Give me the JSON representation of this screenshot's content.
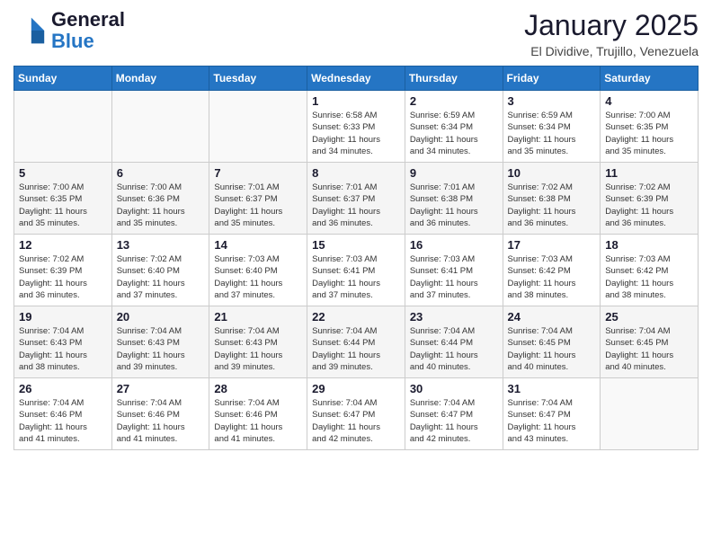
{
  "header": {
    "logo_general": "General",
    "logo_blue": "Blue",
    "month": "January 2025",
    "location": "El Dividive, Trujillo, Venezuela"
  },
  "days_of_week": [
    "Sunday",
    "Monday",
    "Tuesday",
    "Wednesday",
    "Thursday",
    "Friday",
    "Saturday"
  ],
  "weeks": [
    [
      {
        "day": "",
        "info": ""
      },
      {
        "day": "",
        "info": ""
      },
      {
        "day": "",
        "info": ""
      },
      {
        "day": "1",
        "info": "Sunrise: 6:58 AM\nSunset: 6:33 PM\nDaylight: 11 hours\nand 34 minutes."
      },
      {
        "day": "2",
        "info": "Sunrise: 6:59 AM\nSunset: 6:34 PM\nDaylight: 11 hours\nand 34 minutes."
      },
      {
        "day": "3",
        "info": "Sunrise: 6:59 AM\nSunset: 6:34 PM\nDaylight: 11 hours\nand 35 minutes."
      },
      {
        "day": "4",
        "info": "Sunrise: 7:00 AM\nSunset: 6:35 PM\nDaylight: 11 hours\nand 35 minutes."
      }
    ],
    [
      {
        "day": "5",
        "info": "Sunrise: 7:00 AM\nSunset: 6:35 PM\nDaylight: 11 hours\nand 35 minutes."
      },
      {
        "day": "6",
        "info": "Sunrise: 7:00 AM\nSunset: 6:36 PM\nDaylight: 11 hours\nand 35 minutes."
      },
      {
        "day": "7",
        "info": "Sunrise: 7:01 AM\nSunset: 6:37 PM\nDaylight: 11 hours\nand 35 minutes."
      },
      {
        "day": "8",
        "info": "Sunrise: 7:01 AM\nSunset: 6:37 PM\nDaylight: 11 hours\nand 36 minutes."
      },
      {
        "day": "9",
        "info": "Sunrise: 7:01 AM\nSunset: 6:38 PM\nDaylight: 11 hours\nand 36 minutes."
      },
      {
        "day": "10",
        "info": "Sunrise: 7:02 AM\nSunset: 6:38 PM\nDaylight: 11 hours\nand 36 minutes."
      },
      {
        "day": "11",
        "info": "Sunrise: 7:02 AM\nSunset: 6:39 PM\nDaylight: 11 hours\nand 36 minutes."
      }
    ],
    [
      {
        "day": "12",
        "info": "Sunrise: 7:02 AM\nSunset: 6:39 PM\nDaylight: 11 hours\nand 36 minutes."
      },
      {
        "day": "13",
        "info": "Sunrise: 7:02 AM\nSunset: 6:40 PM\nDaylight: 11 hours\nand 37 minutes."
      },
      {
        "day": "14",
        "info": "Sunrise: 7:03 AM\nSunset: 6:40 PM\nDaylight: 11 hours\nand 37 minutes."
      },
      {
        "day": "15",
        "info": "Sunrise: 7:03 AM\nSunset: 6:41 PM\nDaylight: 11 hours\nand 37 minutes."
      },
      {
        "day": "16",
        "info": "Sunrise: 7:03 AM\nSunset: 6:41 PM\nDaylight: 11 hours\nand 37 minutes."
      },
      {
        "day": "17",
        "info": "Sunrise: 7:03 AM\nSunset: 6:42 PM\nDaylight: 11 hours\nand 38 minutes."
      },
      {
        "day": "18",
        "info": "Sunrise: 7:03 AM\nSunset: 6:42 PM\nDaylight: 11 hours\nand 38 minutes."
      }
    ],
    [
      {
        "day": "19",
        "info": "Sunrise: 7:04 AM\nSunset: 6:43 PM\nDaylight: 11 hours\nand 38 minutes."
      },
      {
        "day": "20",
        "info": "Sunrise: 7:04 AM\nSunset: 6:43 PM\nDaylight: 11 hours\nand 39 minutes."
      },
      {
        "day": "21",
        "info": "Sunrise: 7:04 AM\nSunset: 6:43 PM\nDaylight: 11 hours\nand 39 minutes."
      },
      {
        "day": "22",
        "info": "Sunrise: 7:04 AM\nSunset: 6:44 PM\nDaylight: 11 hours\nand 39 minutes."
      },
      {
        "day": "23",
        "info": "Sunrise: 7:04 AM\nSunset: 6:44 PM\nDaylight: 11 hours\nand 40 minutes."
      },
      {
        "day": "24",
        "info": "Sunrise: 7:04 AM\nSunset: 6:45 PM\nDaylight: 11 hours\nand 40 minutes."
      },
      {
        "day": "25",
        "info": "Sunrise: 7:04 AM\nSunset: 6:45 PM\nDaylight: 11 hours\nand 40 minutes."
      }
    ],
    [
      {
        "day": "26",
        "info": "Sunrise: 7:04 AM\nSunset: 6:46 PM\nDaylight: 11 hours\nand 41 minutes."
      },
      {
        "day": "27",
        "info": "Sunrise: 7:04 AM\nSunset: 6:46 PM\nDaylight: 11 hours\nand 41 minutes."
      },
      {
        "day": "28",
        "info": "Sunrise: 7:04 AM\nSunset: 6:46 PM\nDaylight: 11 hours\nand 41 minutes."
      },
      {
        "day": "29",
        "info": "Sunrise: 7:04 AM\nSunset: 6:47 PM\nDaylight: 11 hours\nand 42 minutes."
      },
      {
        "day": "30",
        "info": "Sunrise: 7:04 AM\nSunset: 6:47 PM\nDaylight: 11 hours\nand 42 minutes."
      },
      {
        "day": "31",
        "info": "Sunrise: 7:04 AM\nSunset: 6:47 PM\nDaylight: 11 hours\nand 43 minutes."
      },
      {
        "day": "",
        "info": ""
      }
    ]
  ]
}
